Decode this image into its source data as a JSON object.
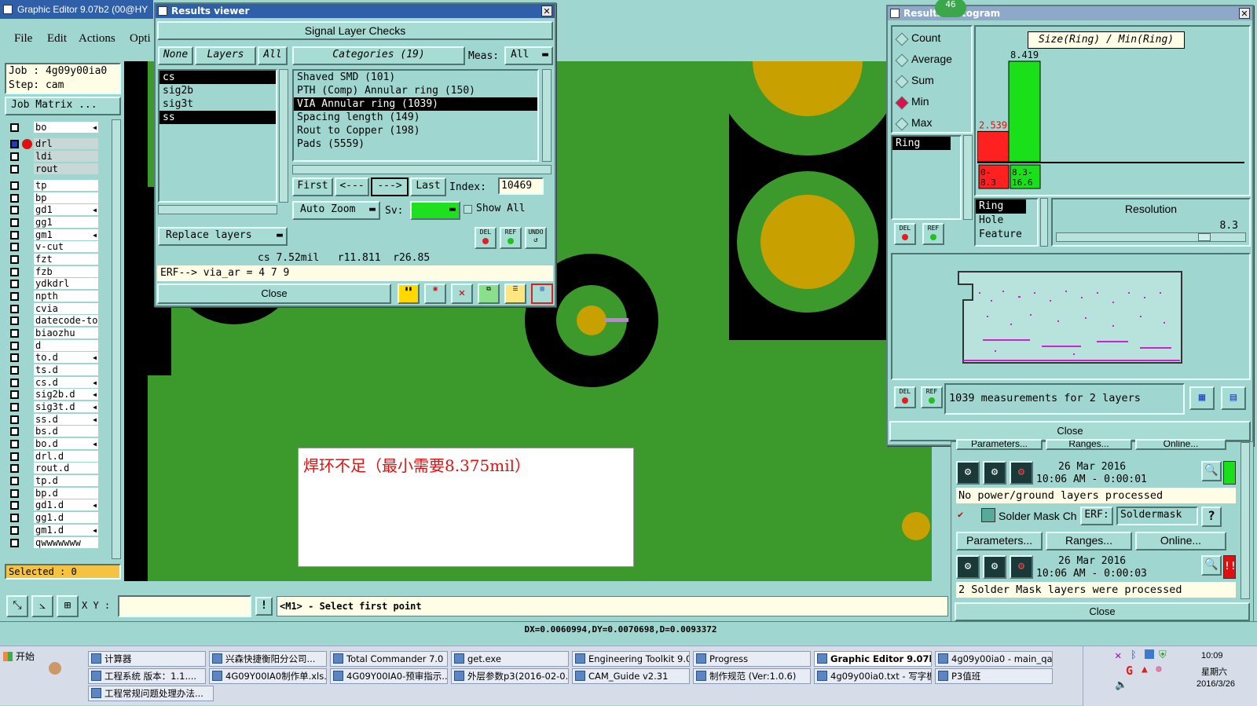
{
  "app": {
    "title": "Graphic Editor 9.07b2 (00@HY",
    "menu": [
      "File",
      "Edit",
      "Actions",
      "Opti"
    ]
  },
  "left_panel": {
    "job_label": "Job : 4g09y00ia0",
    "step_label": "Step: cam",
    "job_matrix": "Job Matrix ...",
    "layers": [
      "bo",
      "drl",
      "ldi",
      "rout",
      "tp",
      "bp",
      "gd1",
      "gg1",
      "gm1",
      "v-cut",
      "fzt",
      "fzb",
      "ydkdrl",
      "npth",
      "cvia",
      "datecode-to",
      "biaozhu",
      "d",
      "to.d",
      "ts.d",
      "cs.d",
      "sig2b.d",
      "sig3t.d",
      "ss.d",
      "bs.d",
      "bo.d",
      "drl.d",
      "rout.d",
      "tp.d",
      "bp.d",
      "gd1.d",
      "gg1.d",
      "gm1.d",
      "qwwwwwww"
    ],
    "selected": "Selected : 0"
  },
  "bottom_bar": {
    "xy_label": "X Y :",
    "xy_value": "",
    "prompt": "<M1> - Select first point",
    "status": "DX=0.0060994,DY=0.0070698,D=0.0093372"
  },
  "annotation": {
    "text": "焊环不足（最小需要8.375mil）"
  },
  "results_viewer": {
    "title": "Results viewer",
    "heading": "Signal Layer Checks",
    "none_btn": "None",
    "layers_btn": "Layers",
    "all_btn": "All",
    "categories_label": "Categories (19)",
    "meas_label": "Meas:",
    "meas_value": "All",
    "layer_list": [
      "cs",
      "sig2b",
      "sig3t",
      "ss"
    ],
    "categories": [
      "Shaved SMD (101)",
      "PTH (Comp) Annular ring (150)",
      "VIA Annular ring (1039)",
      "Spacing length (149)",
      "Rout to Copper (198)",
      "Pads (5559)"
    ],
    "first": "First",
    "prev": "<---",
    "next": "--->",
    "last": "Last",
    "index_label": "Index:",
    "index_value": "10469",
    "auto_zoom": "Auto Zoom",
    "sv_label": "Sv:",
    "show_all": "Show All",
    "replace_layers": "Replace layers",
    "del": "DEL",
    "ref": "REF",
    "undo": "UNDO",
    "measure_line": "cs 7.52mil   r11.811  r26.85",
    "erf_line": "ERF--> via_ar = 4 7 9",
    "close": "Close"
  },
  "histogram": {
    "title": "Results histogram",
    "badge": "46",
    "modes": [
      "Count",
      "Average",
      "Sum",
      "Min",
      "Max"
    ],
    "selected_mode": "Min",
    "attr_list": [
      "Ring"
    ],
    "chart_title": "Size(Ring) / Min(Ring)",
    "del": "DEL",
    "ref": "REF",
    "measurements": "1039 measurements for 2 layers",
    "attr_options": [
      "Ring",
      "Hole",
      "Feature"
    ],
    "resolution_label": "Resolution",
    "resolution_value": "8.3",
    "close": "Close"
  },
  "chart_data": {
    "type": "bar",
    "title": "Size(Ring) / Min(Ring)",
    "categories": [
      "0- 8.3",
      "8.3- 16.6"
    ],
    "values": [
      2.539,
      8.419
    ],
    "colors": [
      "#ff2020",
      "#19e019"
    ]
  },
  "qa_panel": {
    "params": "Parameters...",
    "ranges": "Ranges...",
    "online": "Online...",
    "date1": "26 Mar 2016",
    "time1": "10:06 AM - 0:00:01",
    "msg1": "No power/ground layers processed",
    "solder_label": "Solder Mask Ch",
    "erf_label": "ERF:",
    "erf_value": "Soldermask",
    "help": "?",
    "date2": "26 Mar 2016",
    "time2": "10:06 AM - 0:00:03",
    "msg2": "2 Solder Mask layers were processed",
    "close": "Close"
  },
  "taskbar": {
    "start": "开始",
    "row1": [
      "计算器",
      "兴森快捷衡阳分公司...",
      "Total Commander 7.0 p...",
      "get.exe",
      "Engineering Toolkit 9.07...",
      "Progress",
      "Graphic Editor 9.07b...",
      "4g09y00ia0 - main_qa"
    ],
    "row2": [
      "工程系统  版本：1.1....",
      "4G09Y00IA0制作单.xls...",
      "4G09Y00IA0-预审指示...",
      "外层参数p3(2016-02-0...",
      "CAM_Guide v2.31",
      "制作规范 (Ver:1.0.6)",
      "4g09y00ia0.txt - 写字板",
      "P3值班"
    ],
    "row3": [
      "工程常规问题处理办法..."
    ],
    "time": "10:09",
    "weekday": "星期六",
    "date": "2016/3/26"
  }
}
